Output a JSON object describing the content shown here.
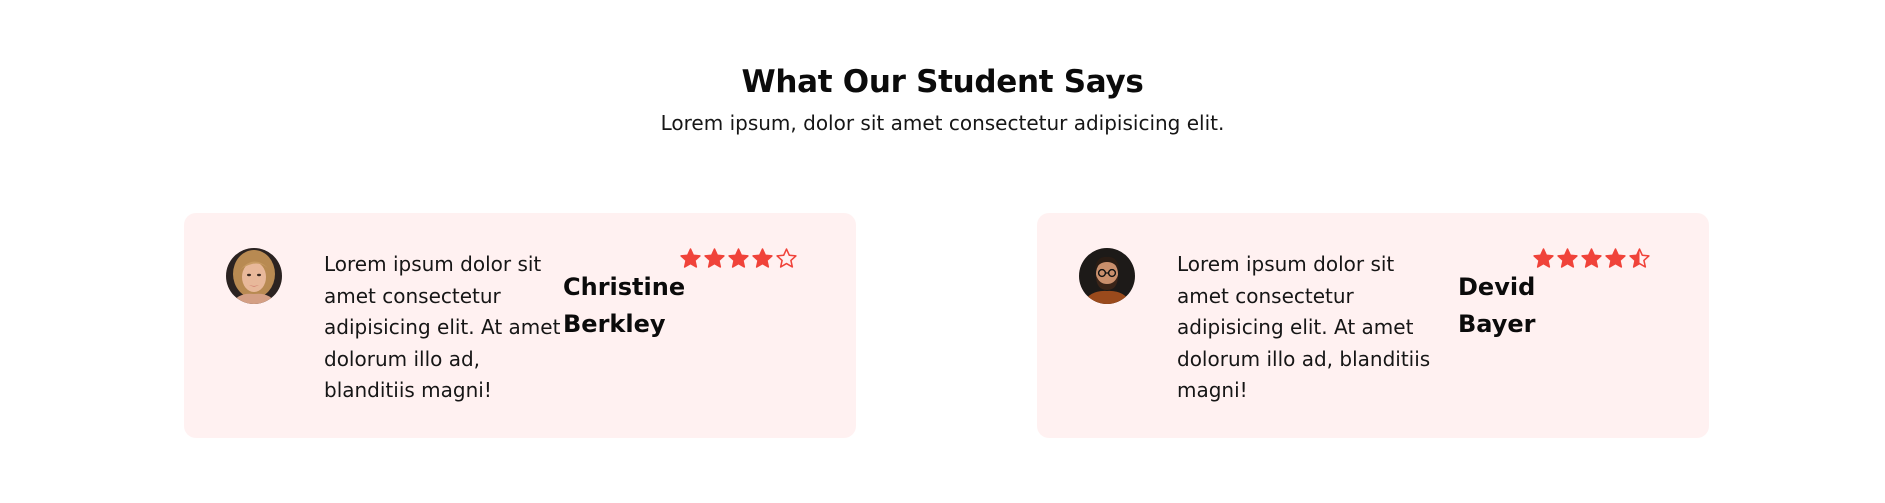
{
  "section": {
    "title": "What Our Student Says",
    "subtitle": "Lorem ipsum, dolor sit amet consectetur adipisicing elit."
  },
  "testimonials": [
    {
      "quote": "Lorem ipsum dolor sit amet consectetur adipisicing elit. At amet dolorum illo ad, blanditiis magni!",
      "name": "Christine Berkley",
      "rating": 4,
      "star_color": "#f0433a",
      "avatar_icon": "avatar-female-icon"
    },
    {
      "quote": "Lorem ipsum dolor sit amet consectetur adipisicing elit. At amet dolorum illo ad, blanditiis magni!",
      "name": "Devid Bayer",
      "rating": 4.5,
      "star_color": "#f0433a",
      "avatar_icon": "avatar-male-icon"
    }
  ],
  "colors": {
    "card_background": "#fff1f1",
    "accent": "#f0433a"
  }
}
